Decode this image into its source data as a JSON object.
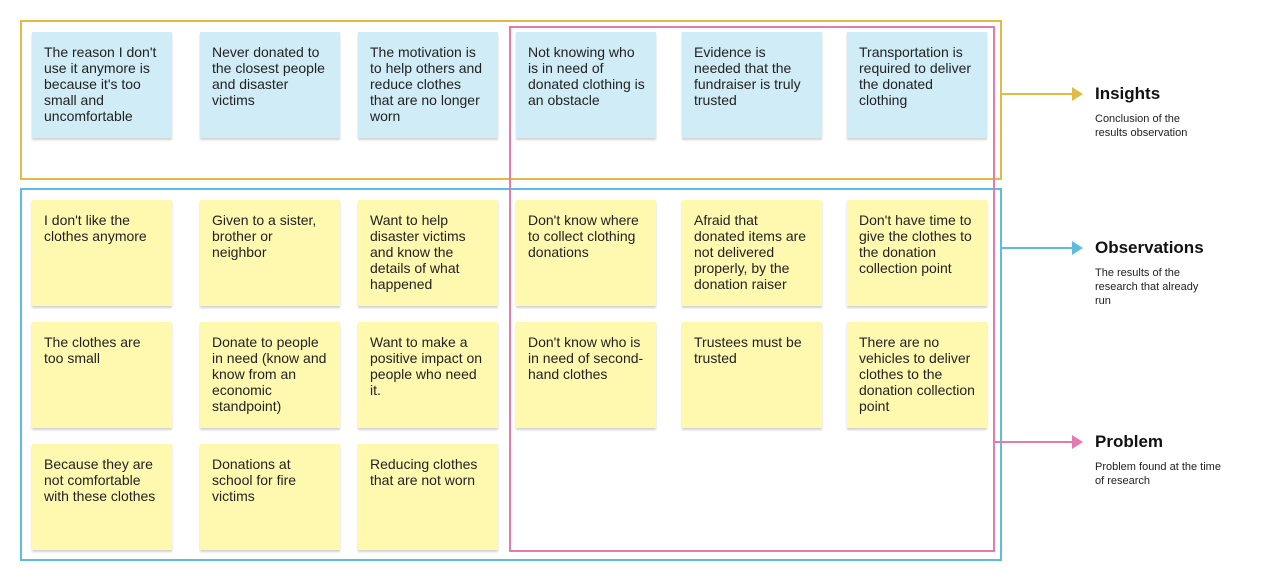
{
  "colors": {
    "insights": "#e2bb45",
    "observations": "#5bbde0",
    "problem": "#e57aac",
    "insight_note": "#d0ecf7",
    "observation_note": "#fff9b0"
  },
  "insights": [
    "The reason I don't use it anymore is because it's too small and uncomfortable",
    "Never donated to the closest people and disaster victims",
    "The motivation is to help others and reduce clothes that are no longer worn",
    "Not knowing who is in need of donated clothing is an obstacle",
    "Evidence is needed that the fundraiser is truly trusted",
    "Transportation is required to deliver the donated clothing"
  ],
  "observations": [
    [
      "I don't like the clothes anymore",
      "Given to a sister, brother or neighbor",
      "Want to help disaster victims and know the details of what happened",
      "Don't know where to collect clothing donations",
      "Afraid that donated items are not delivered properly, by the donation raiser",
      "Don't have time to give the clothes to the donation collection point"
    ],
    [
      "The clothes are too small",
      "Donate to people in need (know and know from an economic standpoint)",
      "Want to make a positive impact on people who need it.",
      "Don't know who is in need of second-hand clothes",
      "Trustees must be trusted",
      "There are no vehicles to deliver clothes to the donation collection point"
    ],
    [
      "Because they are not comfortable with these clothes",
      "Donations at school for fire victims",
      "Reducing clothes that are not worn"
    ]
  ],
  "legend": [
    {
      "title": "Insights",
      "desc": "Conclusion of the results observation"
    },
    {
      "title": "Observations",
      "desc": "The results of the research that already run"
    },
    {
      "title": "Problem",
      "desc": "Problem found at the time of research"
    }
  ]
}
